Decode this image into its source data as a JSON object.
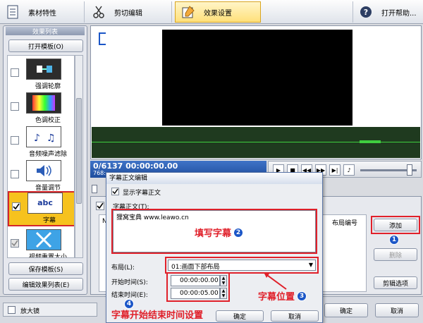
{
  "tabs": [
    {
      "label": "素材特性",
      "icon": "document-icon"
    },
    {
      "label": "剪切编辑",
      "icon": "scissors-icon"
    },
    {
      "label": "效果设置",
      "icon": "effects-icon"
    },
    {
      "label": "打开帮助...",
      "icon": "help-icon"
    }
  ],
  "left_panel": {
    "title": "效果列表",
    "open_template": "打开模板(O)",
    "save_template": "保存模板(S)",
    "edit_effects": "编辑效果列表(E)",
    "items": [
      {
        "label": "强调轮廓",
        "checked": false
      },
      {
        "label": "色调校正",
        "checked": false
      },
      {
        "label": "音频噪声滤除",
        "checked": false
      },
      {
        "label": "音量调节",
        "checked": false
      },
      {
        "label": "字幕",
        "checked": true,
        "thumb_text": "abc"
      },
      {
        "label": "视频重置大小",
        "checked": true
      }
    ]
  },
  "player": {
    "frame_readout": "0/6137  00:00:00.00",
    "resolution": "768:"
  },
  "lower_panel": {
    "list_header_left": "N",
    "list_header_right": "布局编号",
    "add_button": "添加",
    "delete_button": "删除",
    "clip_options": "剪辑选项",
    "subtitle_check_label": "字"
  },
  "dialog": {
    "title": "字幕正文编辑",
    "show_text_label": "显示字幕正文",
    "text_label": "字幕正文(T):",
    "text_value": "狸窝宝典 www.leawo.cn",
    "layout_label": "布局(L):",
    "layout_value": "01:画面下部布局",
    "start_label": "开始时间(S):",
    "start_value": "00:00:00.00",
    "end_label": "结束时间(E):",
    "end_value": "00:00:05.00",
    "ok": "确定",
    "cancel": "取消"
  },
  "annotations": {
    "fill_text": "填写字幕",
    "position": "字幕位置",
    "timing": "字幕开始结束时间设置",
    "n1": "1",
    "n2": "2",
    "n3": "3",
    "n4": "4"
  },
  "bottom": {
    "magnifier": "放大镜",
    "ok": "确定",
    "cancel": "取消"
  }
}
